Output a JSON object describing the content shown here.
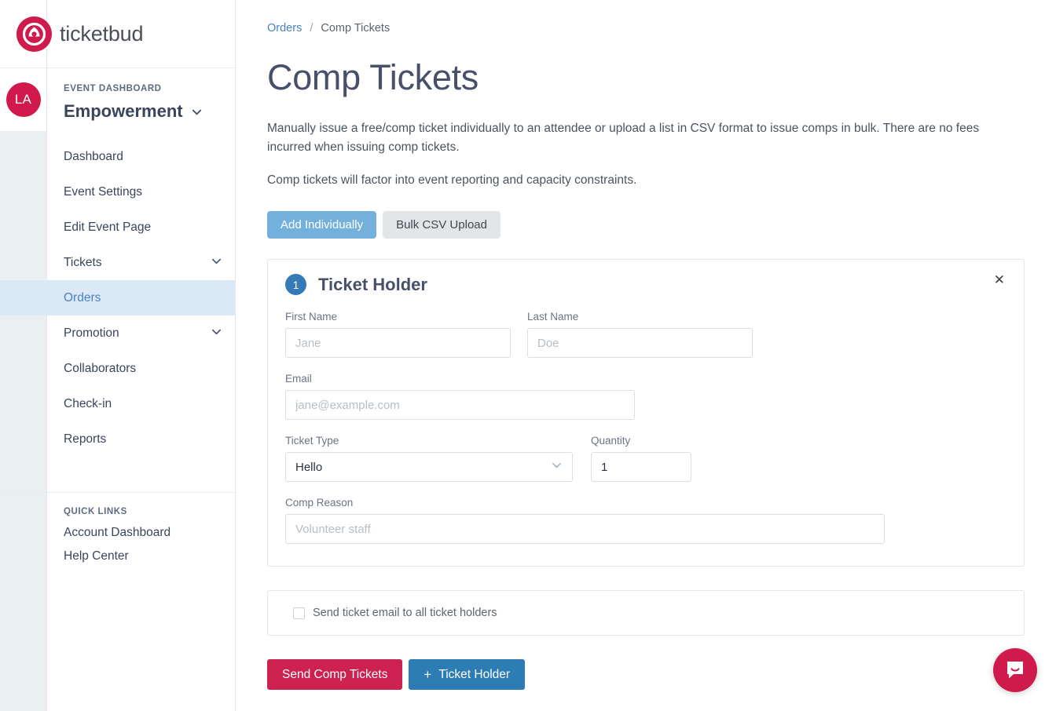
{
  "brand": {
    "name": "ticketbud",
    "logo_icon": "ticketbud-logo-icon"
  },
  "rail": {
    "avatar_initials": "LA"
  },
  "sidebar": {
    "section_label": "EVENT DASHBOARD",
    "event_name": "Empowerment",
    "event_chevron_icon": "chevron-down-icon",
    "items": [
      {
        "label": "Dashboard",
        "active": false,
        "chevron": false
      },
      {
        "label": "Event Settings",
        "active": false,
        "chevron": false
      },
      {
        "label": "Edit Event Page",
        "active": false,
        "chevron": false
      },
      {
        "label": "Tickets",
        "active": false,
        "chevron": true
      },
      {
        "label": "Orders",
        "active": true,
        "chevron": false
      },
      {
        "label": "Promotion",
        "active": false,
        "chevron": true
      },
      {
        "label": "Collaborators",
        "active": false,
        "chevron": false
      },
      {
        "label": "Check-in",
        "active": false,
        "chevron": false
      },
      {
        "label": "Reports",
        "active": false,
        "chevron": false
      }
    ],
    "quick_links_title": "QUICK LINKS",
    "quick_links": [
      {
        "label": "Account Dashboard"
      },
      {
        "label": "Help Center"
      }
    ]
  },
  "breadcrumb": {
    "parent": "Orders",
    "separator": "/",
    "current": "Comp Tickets"
  },
  "page": {
    "title": "Comp Tickets",
    "paragraph_1": "Manually issue a free/comp ticket individually to an attendee or upload a list in CSV format to issue comps in bulk. There are no fees incurred when issuing comp tickets.",
    "paragraph_2": "Comp tickets will factor into event reporting and capacity constraints."
  },
  "mode_toggle": {
    "add_individually": "Add Individually",
    "bulk_csv_upload": "Bulk CSV Upload",
    "active": "Add Individually"
  },
  "ticket_holder_card": {
    "number": "1",
    "title": "Ticket Holder",
    "close_icon": "close-icon",
    "fields": {
      "first_name": {
        "label": "First Name",
        "value": "",
        "placeholder": "Jane"
      },
      "last_name": {
        "label": "Last Name",
        "value": "",
        "placeholder": "Doe"
      },
      "email": {
        "label": "Email",
        "value": "",
        "placeholder": "jane@example.com"
      },
      "ticket_type": {
        "label": "Ticket Type",
        "value": "Hello",
        "options": [
          "Hello"
        ],
        "chevron_icon": "chevron-down-icon"
      },
      "quantity": {
        "label": "Quantity",
        "value": "1",
        "placeholder": ""
      },
      "comp_reason": {
        "label": "Comp Reason",
        "value": "",
        "placeholder": "Volunteer staff"
      }
    }
  },
  "send_email_option": {
    "label": "Send ticket email to all ticket holders",
    "checked": false
  },
  "actions": {
    "send_comp_tickets": "Send Comp Tickets",
    "add_ticket_holder": "Ticket Holder",
    "add_icon": "plus-icon"
  },
  "intercom": {
    "icon": "chat-bubble-icon"
  },
  "colors": {
    "brand_crimson": "#cf1a4c",
    "accent_blue": "#337ab7",
    "active_nav_bg": "#dbe8f5",
    "active_nav_text": "#4b82c3",
    "toggle_active": "#74b0dc",
    "toggle_inactive": "#e3e6e8",
    "danger_button": "#cd2150",
    "info_button": "#2e7cb4",
    "heading_navy": "#46506b",
    "rail_bg": "#eaeff2"
  }
}
